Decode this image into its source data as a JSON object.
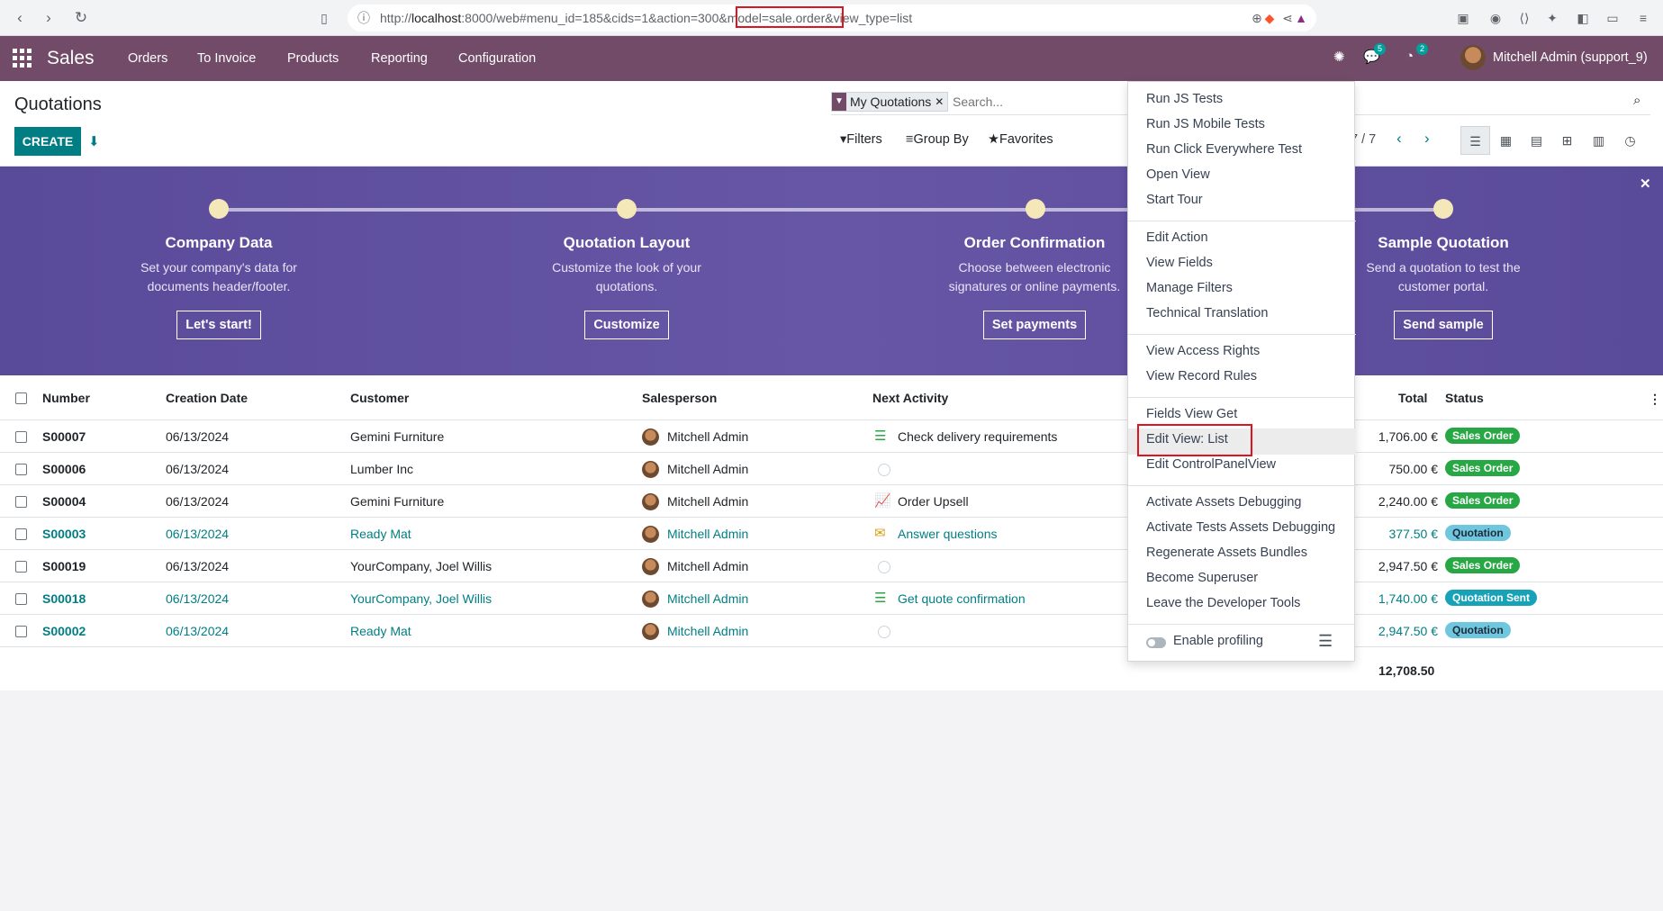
{
  "browser": {
    "url_prefix": "http://",
    "url_host": "localhost",
    "url_rest": ":8000/web#menu_id=185&cids=1&action=300",
    "url_model": "&model=sale.order",
    "url_tail": "&view_type=list",
    "back_label": "‹",
    "forward_label": "›",
    "reload_label": "↻"
  },
  "nav": {
    "brand": "Sales",
    "menus": [
      "Orders",
      "To Invoice",
      "Products",
      "Reporting",
      "Configuration"
    ],
    "chat_count": "5",
    "activity_count": "2",
    "user": "Mitchell Admin (support_9)"
  },
  "control_panel": {
    "title": "Quotations",
    "create_label": "CREATE",
    "facet_label": "My Quotations",
    "search_placeholder": "Search...",
    "filters_label": "Filters",
    "groupby_label": "Group By",
    "favorites_label": "Favorites",
    "pager": "7 / 7"
  },
  "banner": {
    "steps": [
      {
        "title": "Company Data",
        "desc1": "Set your company's data for",
        "desc2": "documents header/footer.",
        "button": "Let's start!"
      },
      {
        "title": "Quotation Layout",
        "desc1": "Customize the look of your",
        "desc2": "quotations.",
        "button": "Customize"
      },
      {
        "title": "Order Confirmation",
        "desc1": "Choose between electronic",
        "desc2": "signatures or online payments.",
        "button": "Set payments"
      },
      {
        "title": "Sample Quotation",
        "desc1": "Send a quotation to test the",
        "desc2": "customer portal.",
        "button": "Send sample"
      }
    ]
  },
  "table": {
    "headers": {
      "number": "Number",
      "date": "Creation Date",
      "customer": "Customer",
      "salesperson": "Salesperson",
      "activity": "Next Activity",
      "total": "Total",
      "status": "Status"
    },
    "rows": [
      {
        "number": "S00007",
        "date": "06/13/2024",
        "customer": "Gemini Furniture",
        "salesperson": "Mitchell Admin",
        "activity": "Check delivery requirements",
        "total": "1,706.00 €",
        "status": "Sales Order"
      },
      {
        "number": "S00006",
        "date": "06/13/2024",
        "customer": "Lumber Inc",
        "salesperson": "Mitchell Admin",
        "activity": "",
        "total": "750.00 €",
        "status": "Sales Order"
      },
      {
        "number": "S00004",
        "date": "06/13/2024",
        "customer": "Gemini Furniture",
        "salesperson": "Mitchell Admin",
        "activity": "Order Upsell",
        "total": "2,240.00 €",
        "status": "Sales Order"
      },
      {
        "number": "S00003",
        "date": "06/13/2024",
        "customer": "Ready Mat",
        "salesperson": "Mitchell Admin",
        "activity": "Answer questions",
        "total": "377.50 €",
        "status": "Quotation"
      },
      {
        "number": "S00019",
        "date": "06/13/2024",
        "customer": "YourCompany, Joel Willis",
        "salesperson": "Mitchell Admin",
        "activity": "",
        "total": "2,947.50 €",
        "status": "Sales Order"
      },
      {
        "number": "S00018",
        "date": "06/13/2024",
        "customer": "YourCompany, Joel Willis",
        "salesperson": "Mitchell Admin",
        "activity": "Get quote confirmation",
        "total": "1,740.00 €",
        "status": "Quotation Sent"
      },
      {
        "number": "S00002",
        "date": "06/13/2024",
        "customer": "Ready Mat",
        "salesperson": "Mitchell Admin",
        "activity": "",
        "total": "2,947.50 €",
        "status": "Quotation"
      }
    ],
    "grand_total": "12,708.50"
  },
  "debug_menu": {
    "group1": [
      "Run JS Tests",
      "Run JS Mobile Tests",
      "Run Click Everywhere Test",
      "Open View",
      "Start Tour"
    ],
    "group2": [
      "Edit Action",
      "View Fields",
      "Manage Filters",
      "Technical Translation"
    ],
    "group3": [
      "View Access Rights",
      "View Record Rules"
    ],
    "group4": [
      "Fields View Get",
      "Edit View: List",
      "Edit ControlPanelView"
    ],
    "group5": [
      "Activate Assets Debugging",
      "Activate Tests Assets Debugging",
      "Regenerate Assets Bundles",
      "Become Superuser",
      "Leave the Developer Tools"
    ],
    "profiling_label": "Enable profiling"
  }
}
